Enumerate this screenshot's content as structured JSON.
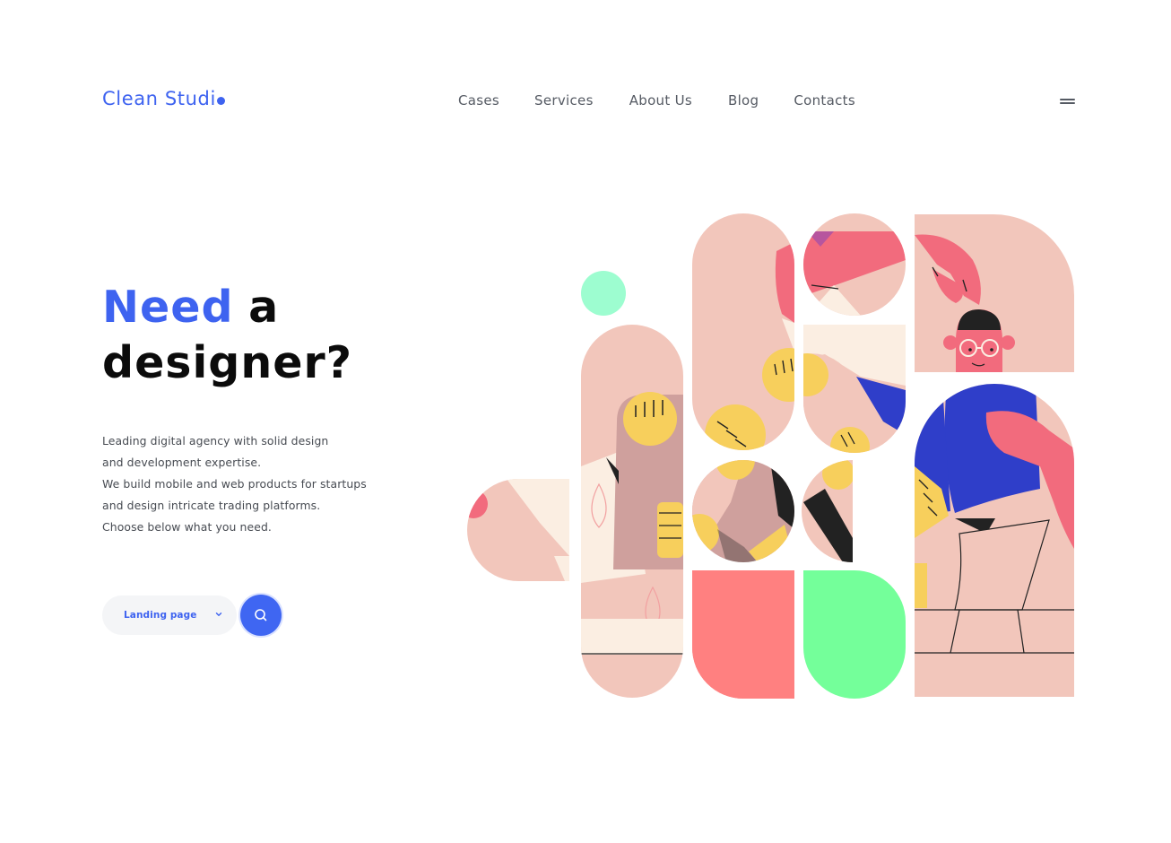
{
  "header": {
    "logo": "Clean Studi",
    "nav": [
      "Cases",
      "Services",
      "About Us",
      "Blog",
      "Contacts"
    ],
    "menu_icon": "hamburger-icon"
  },
  "hero": {
    "headline_accent": "Need",
    "headline_rest_1": "a",
    "headline_rest_2": "designer?",
    "description": [
      "Leading digital agency with solid design",
      "and development expertise.",
      "We build mobile and web products for startups",
      "and design intricate trading platforms.",
      "Choose below what you need."
    ],
    "select_value": "Landing page",
    "search_icon": "search-icon"
  },
  "colors": {
    "brand": "#3e63f0",
    "pink": "#f2c6bb",
    "coral": "#f26b7d",
    "mint": "#9dfdd0",
    "green": "#74ff9a",
    "salmon": "#ff8080",
    "yellow": "#f7cf5c",
    "cobalt": "#2f3ec9"
  }
}
